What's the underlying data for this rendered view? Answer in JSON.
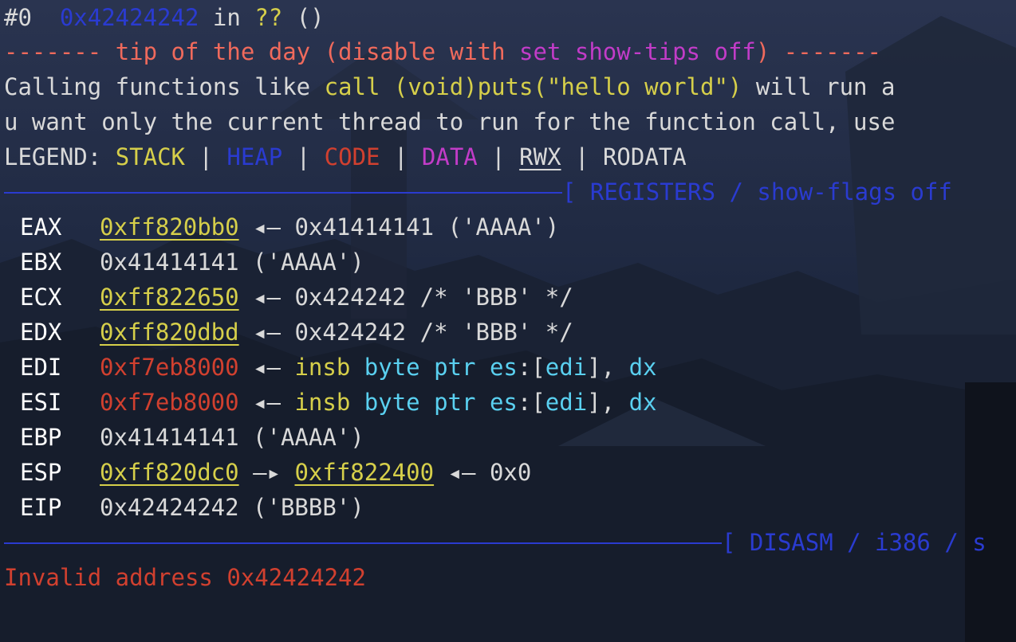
{
  "frame": {
    "index": "#0",
    "address": "0x42424242",
    "in_word": "in",
    "function": "??",
    "args": "()"
  },
  "tip": {
    "dashes_left": "-------",
    "title": "tip of the day",
    "paren_open": "(disable with",
    "command": "set show-tips off",
    "paren_close": ")",
    "dashes_right": "-------",
    "line1_prefix": "Calling functions like ",
    "line1_code": "call (void)puts(\"hello world\")",
    "line1_suffix": " will run a",
    "line2": "u want only the current thread to run for the function call, use"
  },
  "legend": {
    "label": "LEGEND:",
    "stack": "STACK",
    "heap": "HEAP",
    "code": "CODE",
    "data": "DATA",
    "rwx": "RWX",
    "rodata": "RODATA",
    "sep": "|"
  },
  "registers_header": "[ REGISTERS / show-flags off",
  "registers": [
    {
      "name": "EAX",
      "value": "0xff820bb0",
      "arrow": "◂—",
      "rest": "0x41414141 ('AAAA')"
    },
    {
      "name": "EBX",
      "value": "0x41414141 ('AAAA')"
    },
    {
      "name": "ECX",
      "value": "0xff822650",
      "arrow": "◂—",
      "rest": "0x424242 /* 'BBB' */"
    },
    {
      "name": "EDX",
      "value": "0xff820dbd",
      "arrow": "◂—",
      "rest": "0x424242 /* 'BBB' */"
    },
    {
      "name": "EDI",
      "value": "0xf7eb8000",
      "arrow": "◂—",
      "op": "insb",
      "op_a": "byte ptr",
      "op_b": "es",
      "op_c": ":[",
      "op_d": "edi",
      "op_e": "], ",
      "op_f": "dx"
    },
    {
      "name": "ESI",
      "value": "0xf7eb8000",
      "arrow": "◂—",
      "op": "insb",
      "op_a": "byte ptr",
      "op_b": "es",
      "op_c": ":[",
      "op_d": "edi",
      "op_e": "], ",
      "op_f": "dx"
    },
    {
      "name": "EBP",
      "value": "0x41414141 ('AAAA')"
    },
    {
      "name": "ESP",
      "value": "0xff820dc0",
      "arrow": "—▸",
      "value2": "0xff822400",
      "arrow2": "◂—",
      "rest": "0x0"
    },
    {
      "name": "EIP",
      "value": "0x42424242 ('BBBB')"
    }
  ],
  "disasm_header": "[ DISASM / i386 / s",
  "error": "Invalid address 0x42424242",
  "colors": {
    "background": "#1c2536",
    "heap": "#2a3bd0",
    "stack": "#d6cf4a",
    "code": "#d1402f",
    "data": "#c23cc8",
    "tip": "#f06a5c",
    "cyan": "#5ad0f0"
  }
}
